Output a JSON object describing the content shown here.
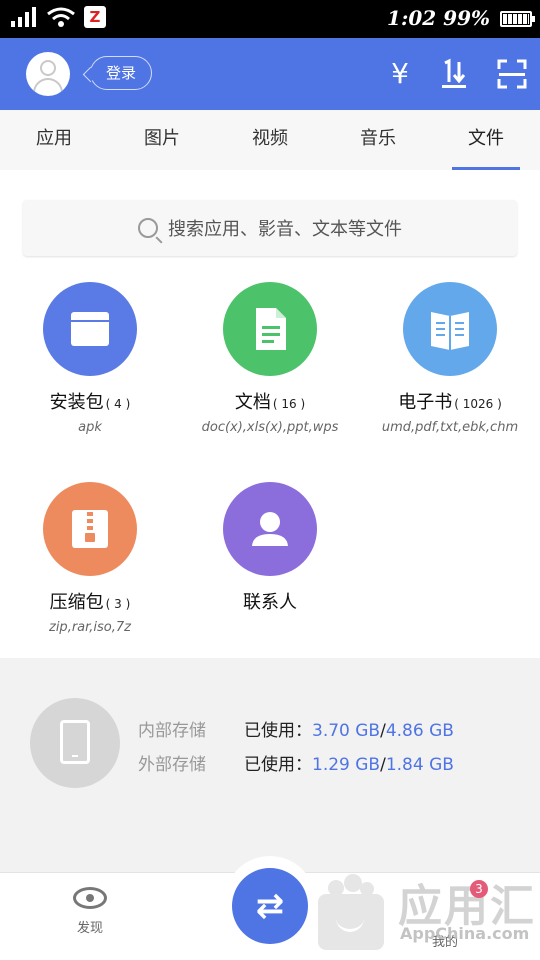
{
  "status_bar": {
    "time": "1:02",
    "battery": "99%",
    "app_badge": "Z"
  },
  "header": {
    "login_label": "登录",
    "yuan_icon": "¥",
    "sort_icon": "1↓",
    "scan_icon": "scan"
  },
  "tabs": [
    {
      "label": "应用",
      "active": false
    },
    {
      "label": "图片",
      "active": false
    },
    {
      "label": "视频",
      "active": false
    },
    {
      "label": "音乐",
      "active": false
    },
    {
      "label": "文件",
      "active": true
    }
  ],
  "search": {
    "placeholder": "搜索应用、影音、文本等文件"
  },
  "categories": [
    {
      "name": "安装包",
      "count": "( 4 )",
      "sub": "apk",
      "color": "#5a7be5",
      "icon": "window-icon"
    },
    {
      "name": "文档",
      "count": "( 16 )",
      "sub": "doc(x),xls(x),ppt,wps",
      "color": "#4cc26a",
      "icon": "document-icon"
    },
    {
      "name": "电子书",
      "count": "( 1026 )",
      "sub": "umd,pdf,txt,ebk,chm",
      "color": "#63a8ea",
      "icon": "book-icon"
    },
    {
      "name": "压缩包",
      "count": "( 3 )",
      "sub": "zip,rar,iso,7z",
      "color": "#ee8b5e",
      "icon": "archive-icon"
    },
    {
      "name": "联系人",
      "count": "",
      "sub": "",
      "color": "#8c6ddc",
      "icon": "contact-icon"
    }
  ],
  "storage": {
    "internal_label": "内部存储",
    "internal_used_label": "已使用：",
    "internal_used": "3.70 GB",
    "internal_total": "4.86 GB",
    "external_label": "外部存储",
    "external_used_label": "已使用：",
    "external_used": "1.29 GB",
    "external_total": "1.84 GB"
  },
  "bottom_nav": {
    "discover_label": "发现",
    "me_label": "我的",
    "fab_icon": "⇄"
  },
  "watermark": {
    "brand": "应用汇",
    "url": "AppChina.com",
    "badge": "3"
  }
}
